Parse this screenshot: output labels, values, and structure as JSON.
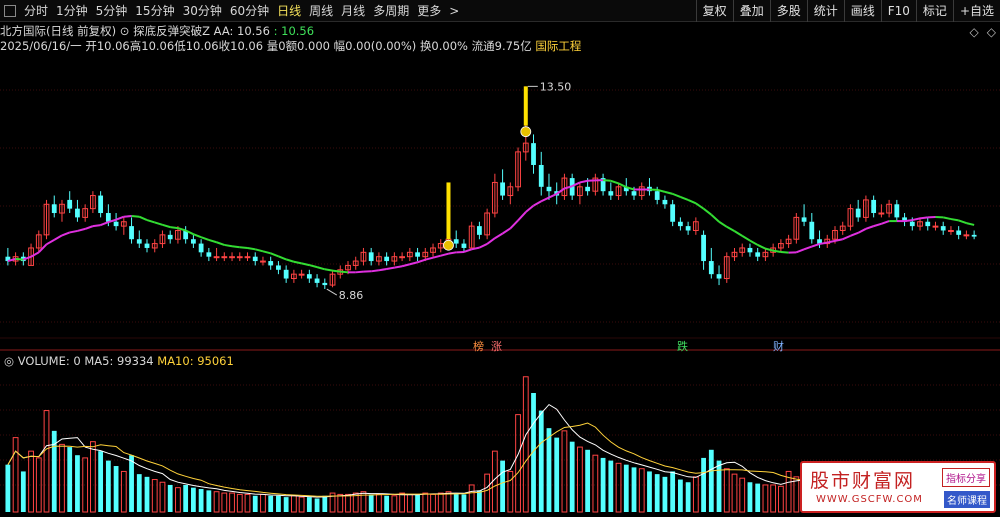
{
  "toolbar": {
    "periods": [
      "分时",
      "1分钟",
      "5分钟",
      "15分钟",
      "30分钟",
      "60分钟",
      "日线",
      "周线",
      "月线",
      "多周期",
      "更多"
    ],
    "active_period": "日线",
    "more_arrow": ">",
    "right_buttons": [
      "复权",
      "叠加",
      "多股",
      "统计",
      "画线",
      "F10",
      "标记",
      "+自选"
    ]
  },
  "info": {
    "stock_name": "北方国际(日线 前复权)",
    "indicator_toggle": "⊙",
    "indicator_name": "探底反弹突破Z",
    "aa_label": "AA: 10.56",
    "aa_value": ": 10.56",
    "date": "2025/06/16/一",
    "open": "开10.06",
    "high": "高10.06",
    "low": "低10.06",
    "close": "收10.06",
    "volume": "量0",
    "amount": "额0.000",
    "change": "幅0.00(0.00%)",
    "turnover": "换0.00%",
    "float_cap": "流通9.75亿",
    "sector": "国际工程",
    "icons": [
      "◇",
      "◇"
    ]
  },
  "markers": {
    "high_price": "13.50",
    "low_price": "8.86",
    "badges": [
      {
        "text": "榜",
        "color": "#ff9040"
      },
      {
        "text": "涨",
        "color": "#ff7070"
      },
      {
        "text": "跌",
        "color": "#40e060"
      },
      {
        "text": "财",
        "color": "#7fb3ff"
      }
    ]
  },
  "volume_legend": {
    "label": "VOLUME: 0",
    "ma5": "MA5: 99334",
    "ma10": "MA10: 95061"
  },
  "watermark": {
    "brand": "股市财富网",
    "url": "WWW.GSCFW.COM",
    "tag1": "指标分享",
    "tag2": "名师课程"
  },
  "colors": {
    "up": "#ff4444",
    "down": "#54ffff",
    "ma_up": "#33dd33",
    "ma_down": "#e030e0",
    "signal": "#ffe100",
    "ma5": "#ffffff",
    "ma10": "#ffd23a"
  },
  "chart_data": {
    "type": "candlestick",
    "title": "北方国际(日线 前复权)",
    "y_range": [
      8.86,
      13.5
    ],
    "candles": [
      {
        "o": 9.6,
        "h": 9.8,
        "l": 9.4,
        "c": 9.5
      },
      {
        "o": 9.5,
        "h": 9.7,
        "l": 9.4,
        "c": 9.6
      },
      {
        "o": 9.6,
        "h": 9.7,
        "l": 9.4,
        "c": 9.5
      },
      {
        "o": 9.4,
        "h": 9.9,
        "l": 9.4,
        "c": 9.8
      },
      {
        "o": 9.8,
        "h": 10.2,
        "l": 9.7,
        "c": 10.1
      },
      {
        "o": 10.1,
        "h": 10.9,
        "l": 10.0,
        "c": 10.8
      },
      {
        "o": 10.8,
        "h": 11.0,
        "l": 10.5,
        "c": 10.6
      },
      {
        "o": 10.6,
        "h": 10.9,
        "l": 10.4,
        "c": 10.8
      },
      {
        "o": 10.9,
        "h": 11.1,
        "l": 10.6,
        "c": 10.7
      },
      {
        "o": 10.7,
        "h": 10.9,
        "l": 10.4,
        "c": 10.5
      },
      {
        "o": 10.5,
        "h": 10.8,
        "l": 10.4,
        "c": 10.7
      },
      {
        "o": 10.7,
        "h": 11.1,
        "l": 10.6,
        "c": 11.0
      },
      {
        "o": 11.0,
        "h": 11.1,
        "l": 10.5,
        "c": 10.6
      },
      {
        "o": 10.6,
        "h": 10.8,
        "l": 10.3,
        "c": 10.4
      },
      {
        "o": 10.4,
        "h": 10.6,
        "l": 10.2,
        "c": 10.3
      },
      {
        "o": 10.3,
        "h": 10.5,
        "l": 10.1,
        "c": 10.4
      },
      {
        "o": 10.3,
        "h": 10.5,
        "l": 9.9,
        "c": 10.0
      },
      {
        "o": 10.0,
        "h": 10.2,
        "l": 9.8,
        "c": 9.9
      },
      {
        "o": 9.9,
        "h": 10.0,
        "l": 9.7,
        "c": 9.8
      },
      {
        "o": 9.8,
        "h": 10.0,
        "l": 9.7,
        "c": 9.9
      },
      {
        "o": 9.9,
        "h": 10.2,
        "l": 9.8,
        "c": 10.1
      },
      {
        "o": 10.1,
        "h": 10.2,
        "l": 9.9,
        "c": 10.0
      },
      {
        "o": 10.0,
        "h": 10.3,
        "l": 9.9,
        "c": 10.2
      },
      {
        "o": 10.2,
        "h": 10.3,
        "l": 9.9,
        "c": 10.0
      },
      {
        "o": 10.0,
        "h": 10.1,
        "l": 9.8,
        "c": 9.9
      },
      {
        "o": 9.9,
        "h": 10.0,
        "l": 9.6,
        "c": 9.7
      },
      {
        "o": 9.7,
        "h": 9.8,
        "l": 9.5,
        "c": 9.6
      },
      {
        "o": 9.6,
        "h": 9.8,
        "l": 9.5,
        "c": 9.6
      },
      {
        "o": 9.6,
        "h": 9.7,
        "l": 9.5,
        "c": 9.6
      },
      {
        "o": 9.6,
        "h": 9.7,
        "l": 9.5,
        "c": 9.6
      },
      {
        "o": 9.6,
        "h": 9.7,
        "l": 9.5,
        "c": 9.6
      },
      {
        "o": 9.6,
        "h": 9.7,
        "l": 9.5,
        "c": 9.6
      },
      {
        "o": 9.6,
        "h": 9.7,
        "l": 9.4,
        "c": 9.5
      },
      {
        "o": 9.5,
        "h": 9.6,
        "l": 9.4,
        "c": 9.5
      },
      {
        "o": 9.5,
        "h": 9.6,
        "l": 9.3,
        "c": 9.4
      },
      {
        "o": 9.4,
        "h": 9.5,
        "l": 9.2,
        "c": 9.3
      },
      {
        "o": 9.3,
        "h": 9.4,
        "l": 9.0,
        "c": 9.1
      },
      {
        "o": 9.1,
        "h": 9.3,
        "l": 9.0,
        "c": 9.2
      },
      {
        "o": 9.2,
        "h": 9.3,
        "l": 9.1,
        "c": 9.2
      },
      {
        "o": 9.2,
        "h": 9.3,
        "l": 9.0,
        "c": 9.1
      },
      {
        "o": 9.1,
        "h": 9.2,
        "l": 8.9,
        "c": 9.0
      },
      {
        "o": 9.0,
        "h": 9.1,
        "l": 8.86,
        "c": 8.95
      },
      {
        "o": 8.95,
        "h": 9.3,
        "l": 8.9,
        "c": 9.2
      },
      {
        "o": 9.2,
        "h": 9.4,
        "l": 9.1,
        "c": 9.3
      },
      {
        "o": 9.3,
        "h": 9.5,
        "l": 9.2,
        "c": 9.4
      },
      {
        "o": 9.4,
        "h": 9.6,
        "l": 9.3,
        "c": 9.5
      },
      {
        "o": 9.5,
        "h": 9.8,
        "l": 9.4,
        "c": 9.7
      },
      {
        "o": 9.7,
        "h": 9.8,
        "l": 9.4,
        "c": 9.5
      },
      {
        "o": 9.5,
        "h": 9.7,
        "l": 9.4,
        "c": 9.6
      },
      {
        "o": 9.6,
        "h": 9.7,
        "l": 9.4,
        "c": 9.5
      },
      {
        "o": 9.5,
        "h": 9.7,
        "l": 9.4,
        "c": 9.6
      },
      {
        "o": 9.6,
        "h": 9.7,
        "l": 9.5,
        "c": 9.6
      },
      {
        "o": 9.6,
        "h": 9.8,
        "l": 9.5,
        "c": 9.7
      },
      {
        "o": 9.7,
        "h": 9.8,
        "l": 9.5,
        "c": 9.6
      },
      {
        "o": 9.6,
        "h": 9.8,
        "l": 9.5,
        "c": 9.7
      },
      {
        "o": 9.7,
        "h": 9.9,
        "l": 9.6,
        "c": 9.8
      },
      {
        "o": 9.8,
        "h": 10.0,
        "l": 9.7,
        "c": 9.9
      },
      {
        "o": 9.9,
        "h": 10.1,
        "l": 9.8,
        "c": 10.0
      },
      {
        "o": 10.0,
        "h": 10.2,
        "l": 9.8,
        "c": 9.9
      },
      {
        "o": 9.9,
        "h": 10.0,
        "l": 9.7,
        "c": 9.8
      },
      {
        "o": 9.8,
        "h": 10.4,
        "l": 9.8,
        "c": 10.3
      },
      {
        "o": 10.3,
        "h": 10.4,
        "l": 10.0,
        "c": 10.1
      },
      {
        "o": 10.1,
        "h": 10.7,
        "l": 10.0,
        "c": 10.6
      },
      {
        "o": 10.6,
        "h": 11.5,
        "l": 10.5,
        "c": 11.3
      },
      {
        "o": 11.3,
        "h": 11.6,
        "l": 10.9,
        "c": 11.0
      },
      {
        "o": 11.0,
        "h": 11.3,
        "l": 10.8,
        "c": 11.2
      },
      {
        "o": 11.2,
        "h": 12.1,
        "l": 11.1,
        "c": 12.0
      },
      {
        "o": 12.0,
        "h": 13.5,
        "l": 11.8,
        "c": 12.2
      },
      {
        "o": 12.2,
        "h": 12.4,
        "l": 11.5,
        "c": 11.7
      },
      {
        "o": 11.7,
        "h": 12.0,
        "l": 11.0,
        "c": 11.2
      },
      {
        "o": 11.2,
        "h": 11.5,
        "l": 10.9,
        "c": 11.1
      },
      {
        "o": 11.1,
        "h": 11.3,
        "l": 10.8,
        "c": 11.0
      },
      {
        "o": 11.0,
        "h": 11.5,
        "l": 10.9,
        "c": 11.4
      },
      {
        "o": 11.4,
        "h": 11.5,
        "l": 10.9,
        "c": 11.0
      },
      {
        "o": 11.0,
        "h": 11.3,
        "l": 10.8,
        "c": 11.2
      },
      {
        "o": 11.2,
        "h": 11.4,
        "l": 11.0,
        "c": 11.1
      },
      {
        "o": 11.1,
        "h": 11.5,
        "l": 11.0,
        "c": 11.4
      },
      {
        "o": 11.4,
        "h": 11.5,
        "l": 11.0,
        "c": 11.1
      },
      {
        "o": 11.1,
        "h": 11.3,
        "l": 10.9,
        "c": 11.0
      },
      {
        "o": 11.0,
        "h": 11.3,
        "l": 10.9,
        "c": 11.2
      },
      {
        "o": 11.2,
        "h": 11.4,
        "l": 11.0,
        "c": 11.1
      },
      {
        "o": 11.1,
        "h": 11.2,
        "l": 10.9,
        "c": 11.0
      },
      {
        "o": 11.0,
        "h": 11.3,
        "l": 10.9,
        "c": 11.2
      },
      {
        "o": 11.2,
        "h": 11.4,
        "l": 11.0,
        "c": 11.1
      },
      {
        "o": 11.1,
        "h": 11.2,
        "l": 10.8,
        "c": 10.9
      },
      {
        "o": 10.9,
        "h": 11.0,
        "l": 10.7,
        "c": 10.8
      },
      {
        "o": 10.8,
        "h": 10.9,
        "l": 10.3,
        "c": 10.4
      },
      {
        "o": 10.4,
        "h": 10.5,
        "l": 10.2,
        "c": 10.3
      },
      {
        "o": 10.3,
        "h": 10.4,
        "l": 10.1,
        "c": 10.2
      },
      {
        "o": 10.2,
        "h": 10.5,
        "l": 10.1,
        "c": 10.4
      },
      {
        "o": 10.1,
        "h": 10.2,
        "l": 9.3,
        "c": 9.5
      },
      {
        "o": 9.5,
        "h": 9.8,
        "l": 9.1,
        "c": 9.2
      },
      {
        "o": 9.2,
        "h": 9.4,
        "l": 8.95,
        "c": 9.1
      },
      {
        "o": 9.1,
        "h": 9.7,
        "l": 9.0,
        "c": 9.6
      },
      {
        "o": 9.6,
        "h": 9.8,
        "l": 9.5,
        "c": 9.7
      },
      {
        "o": 9.7,
        "h": 9.9,
        "l": 9.6,
        "c": 9.8
      },
      {
        "o": 9.8,
        "h": 9.9,
        "l": 9.6,
        "c": 9.7
      },
      {
        "o": 9.7,
        "h": 9.8,
        "l": 9.5,
        "c": 9.6
      },
      {
        "o": 9.6,
        "h": 9.8,
        "l": 9.5,
        "c": 9.7
      },
      {
        "o": 9.7,
        "h": 9.9,
        "l": 9.6,
        "c": 9.8
      },
      {
        "o": 9.8,
        "h": 10.0,
        "l": 9.7,
        "c": 9.9
      },
      {
        "o": 9.9,
        "h": 10.1,
        "l": 9.8,
        "c": 10.0
      },
      {
        "o": 10.0,
        "h": 10.6,
        "l": 9.9,
        "c": 10.5
      },
      {
        "o": 10.5,
        "h": 10.8,
        "l": 10.3,
        "c": 10.4
      },
      {
        "o": 10.4,
        "h": 10.6,
        "l": 9.9,
        "c": 10.0
      },
      {
        "o": 10.0,
        "h": 10.2,
        "l": 9.8,
        "c": 9.9
      },
      {
        "o": 9.9,
        "h": 10.1,
        "l": 9.8,
        "c": 10.0
      },
      {
        "o": 10.0,
        "h": 10.3,
        "l": 9.9,
        "c": 10.2
      },
      {
        "o": 10.2,
        "h": 10.4,
        "l": 10.1,
        "c": 10.3
      },
      {
        "o": 10.3,
        "h": 10.8,
        "l": 10.2,
        "c": 10.7
      },
      {
        "o": 10.7,
        "h": 10.9,
        "l": 10.4,
        "c": 10.5
      },
      {
        "o": 10.5,
        "h": 11.0,
        "l": 10.4,
        "c": 10.9
      },
      {
        "o": 10.9,
        "h": 11.0,
        "l": 10.5,
        "c": 10.6
      },
      {
        "o": 10.6,
        "h": 10.8,
        "l": 10.5,
        "c": 10.6
      },
      {
        "o": 10.6,
        "h": 10.9,
        "l": 10.5,
        "c": 10.8
      },
      {
        "o": 10.8,
        "h": 10.9,
        "l": 10.4,
        "c": 10.5
      },
      {
        "o": 10.5,
        "h": 10.6,
        "l": 10.3,
        "c": 10.4
      },
      {
        "o": 10.4,
        "h": 10.5,
        "l": 10.2,
        "c": 10.3
      },
      {
        "o": 10.3,
        "h": 10.5,
        "l": 10.2,
        "c": 10.4
      },
      {
        "o": 10.4,
        "h": 10.5,
        "l": 10.2,
        "c": 10.3
      },
      {
        "o": 10.3,
        "h": 10.4,
        "l": 10.2,
        "c": 10.3
      },
      {
        "o": 10.3,
        "h": 10.4,
        "l": 10.1,
        "c": 10.2
      },
      {
        "o": 10.2,
        "h": 10.3,
        "l": 10.1,
        "c": 10.2
      },
      {
        "o": 10.2,
        "h": 10.3,
        "l": 10.0,
        "c": 10.1
      },
      {
        "o": 10.1,
        "h": 10.2,
        "l": 10.0,
        "c": 10.1
      },
      {
        "o": 10.1,
        "h": 10.2,
        "l": 10.0,
        "c": 10.06
      }
    ],
    "volumes": [
      35,
      55,
      30,
      45,
      40,
      75,
      60,
      50,
      48,
      42,
      40,
      52,
      45,
      38,
      34,
      30,
      42,
      28,
      26,
      24,
      22,
      20,
      18,
      20,
      18,
      17,
      16,
      15,
      14,
      14,
      13,
      13,
      12,
      13,
      12,
      12,
      11,
      12,
      11,
      11,
      10,
      12,
      14,
      13,
      13,
      14,
      15,
      13,
      13,
      12,
      12,
      14,
      13,
      13,
      14,
      13,
      14,
      15,
      14,
      13,
      20,
      16,
      28,
      45,
      38,
      30,
      72,
      100,
      88,
      75,
      62,
      55,
      60,
      52,
      48,
      46,
      42,
      40,
      38,
      36,
      35,
      33,
      32,
      30,
      28,
      26,
      30,
      24,
      22,
      26,
      40,
      46,
      38,
      32,
      28,
      25,
      22,
      21,
      20,
      20,
      19,
      30,
      26,
      24,
      22,
      20,
      22,
      24,
      28,
      26,
      30,
      27,
      26,
      24,
      22,
      20,
      19,
      18,
      17,
      16,
      16,
      15,
      15,
      14
    ]
  }
}
